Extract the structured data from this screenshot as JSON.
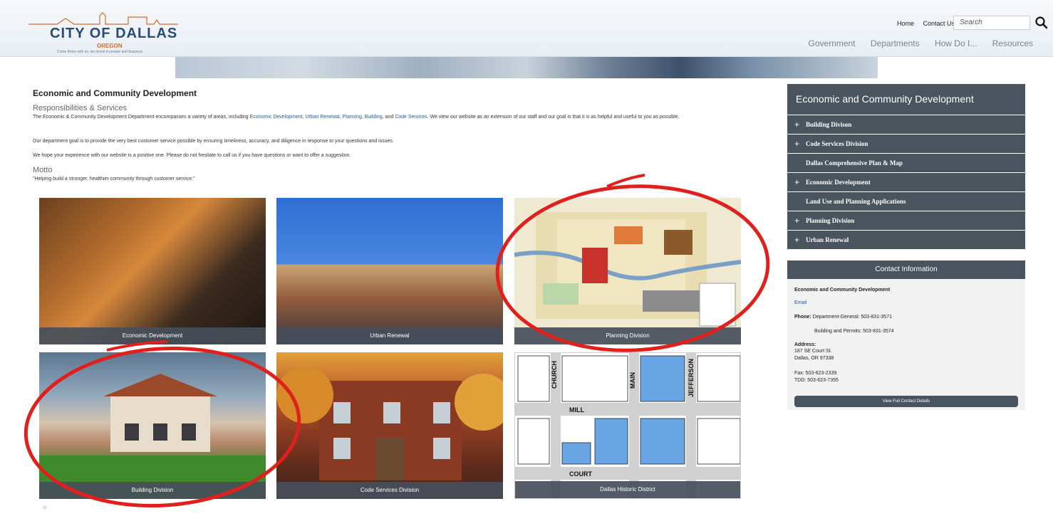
{
  "site": {
    "logo_title": "CITY OF DALLAS",
    "logo_subtitle": "OREGON",
    "logo_tagline": "Come thrive with us, we invest in people and business"
  },
  "header": {
    "top_links": [
      "Home",
      "Contact Us"
    ],
    "search_placeholder": "Search",
    "nav": [
      "Government",
      "Departments",
      "How Do I...",
      "Resources"
    ]
  },
  "main": {
    "title": "Economic and Community Development",
    "responsibilities_heading": "Responsibilities & Services",
    "intro_before": "The Economic & Community Development Department encompasses a variety of areas, including ",
    "intro_links": [
      "Economic Development",
      "Urban Renewal",
      "Planning",
      "Building",
      "Code Services"
    ],
    "intro_after": ". We view our website as an extension of our staff and our goal is that it is as helpful and useful to you as possible.",
    "goal_text": "Our department goal is to provide the very best customer service possible by ensuring timeliness, accuracy, and diligence in response to your questions and issues.",
    "hope_text": "We hope your experience with our website is a positive one. Please do not hesitate to call us if you have questions or want to offer a suggestion.",
    "motto_heading": "Motto",
    "motto_text": "\"Helping build a stronger, healthier community through customer service.\""
  },
  "tiles": [
    {
      "label": "Economic Development"
    },
    {
      "label": "Urban Renewal"
    },
    {
      "label": "Planning Division"
    },
    {
      "label": "Building Division"
    },
    {
      "label": "Code Services Division"
    },
    {
      "label": "Dallas Historic District"
    }
  ],
  "historic_map": {
    "streets": [
      "CHURCH",
      "MAIN",
      "JEFFERSON",
      "MILL",
      "COURT"
    ]
  },
  "sidebar": {
    "title": "Economic and Community Development",
    "items": [
      {
        "label": "Building Divison",
        "expandable": true
      },
      {
        "label": "Code Services Division",
        "expandable": true
      },
      {
        "label": "Dallas Comprehensive Plan & Map",
        "expandable": false
      },
      {
        "label": "Economic Development",
        "expandable": true
      },
      {
        "label": "Land Use and Planning Applications",
        "expandable": false
      },
      {
        "label": "Planning Division",
        "expandable": true
      },
      {
        "label": "Urban Renewal",
        "expandable": true
      }
    ]
  },
  "contact": {
    "heading": "Contact Information",
    "dept": "Economic and Community Development",
    "email": "Email",
    "phone_label": "Phone:",
    "phone_general": "Department-General:  503-831-3571",
    "phone_building": "Building and Permits:  503-831-3574",
    "address_label": "Address:",
    "address_line1": "187 SE Court St.",
    "address_line2": "Dallas, OR 97338",
    "fax": "Fax: 503-623-2339",
    "tdd": "TDD: 503-623-7355",
    "button": "View Full Contact Details"
  },
  "colors": {
    "sidebar_bg": "#4a545e",
    "link": "#1c5fa8",
    "annotation": "#e0201c"
  }
}
